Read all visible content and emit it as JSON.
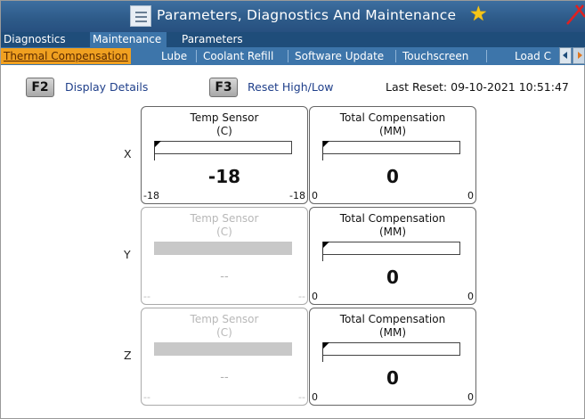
{
  "title": "Parameters, Diagnostics And Maintenance",
  "tabs_primary": [
    "Diagnostics",
    "Maintenance",
    "Parameters"
  ],
  "tabs_primary_active": "Maintenance",
  "tabs_secondary": [
    "Thermal Compensation",
    "Lube",
    "Coolant Refill",
    "Software Update",
    "Touchscreen",
    "Load C"
  ],
  "tabs_secondary_active": "Thermal Compensation",
  "toolbar": {
    "f2_key": "F2",
    "f2_label": "Display Details",
    "f3_key": "F3",
    "f3_label": "Reset High/Low",
    "last_reset": "Last Reset: 09-10-2021 10:51:47"
  },
  "rows": [
    {
      "axis": "X",
      "temp": {
        "title": "Temp Sensor",
        "unit": "(C)",
        "value": "-18",
        "min": "-18",
        "max": "-18",
        "enabled": true
      },
      "comp": {
        "title": "Total Compensation",
        "unit": "(MM)",
        "value": "0",
        "min": "0",
        "max": "0"
      }
    },
    {
      "axis": "Y",
      "temp": {
        "title": "Temp Sensor",
        "unit": "(C)",
        "value": "--",
        "min": "--",
        "max": "--",
        "enabled": false
      },
      "comp": {
        "title": "Total Compensation",
        "unit": "(MM)",
        "value": "0",
        "min": "0",
        "max": "0"
      }
    },
    {
      "axis": "Z",
      "temp": {
        "title": "Temp Sensor",
        "unit": "(C)",
        "value": "--",
        "min": "--",
        "max": "--",
        "enabled": false
      },
      "comp": {
        "title": "Total Compensation",
        "unit": "(MM)",
        "value": "0",
        "min": "0",
        "max": "0"
      }
    }
  ],
  "colors": {
    "titlebar": "#2d5a88",
    "tab_active": "#f0a020",
    "favorite_star": "#f5c518",
    "close_x": "#e02020"
  },
  "icons": {
    "menu": "hamburger-menu-icon",
    "favorite": "star-icon",
    "close": "close-icon",
    "scroll_left": "arrow-left-icon",
    "scroll_right": "arrow-right-icon"
  }
}
